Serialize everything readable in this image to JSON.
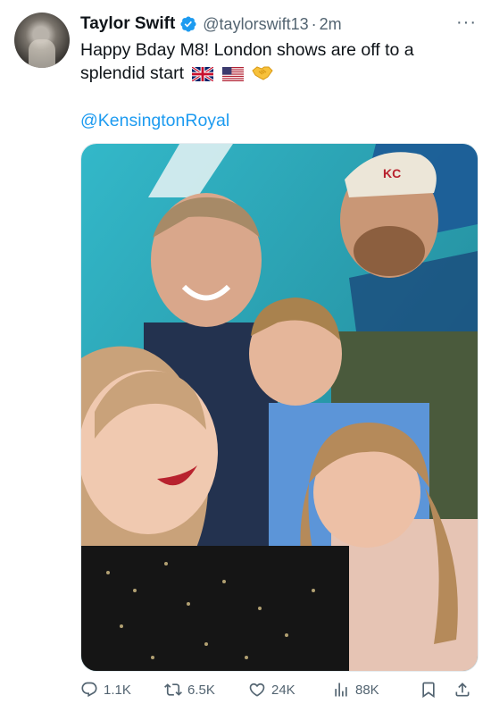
{
  "tweet": {
    "display_name": "Taylor Swift",
    "handle": "@taylorswift13",
    "separator": "·",
    "time": "2m",
    "more_icon": "more-options-icon",
    "text": "Happy Bday M8! London shows are off to a splendid start",
    "emojis": [
      "uk-flag",
      "us-flag",
      "handshake"
    ],
    "mention": "@KensingtonRoyal",
    "photo_logo_text": "KC"
  },
  "actions": {
    "replies": "1.1K",
    "retweets": "6.5K",
    "likes": "24K",
    "views": "88K"
  },
  "colors": {
    "link": "#1d9bf0",
    "verified": "#1d9bf0",
    "secondary_text": "#536471"
  }
}
